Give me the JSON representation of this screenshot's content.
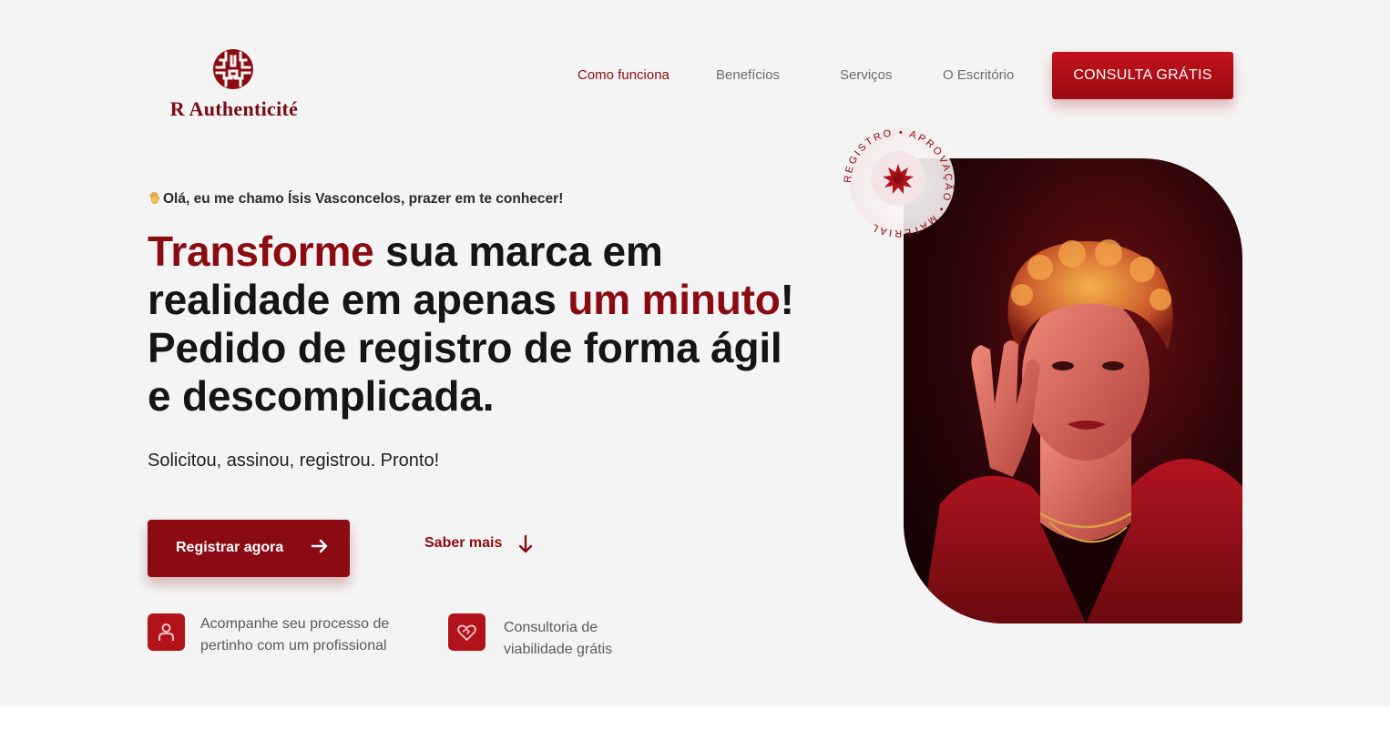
{
  "brand": {
    "name": "R Authenticité",
    "accent_color": "#8a0c12",
    "logo_icon": "circular-maze-logo-icon"
  },
  "nav": {
    "items": [
      {
        "label": "Como funciona",
        "active": true
      },
      {
        "label": "Benefícios",
        "active": false
      },
      {
        "label": "Serviços",
        "active": false
      },
      {
        "label": "O Escritório",
        "active": false
      }
    ],
    "cta_label": "CONSULTA GRÁTIS"
  },
  "hero": {
    "greeting_icon": "waving-hand-icon",
    "greeting": "Olá, eu me chamo Ísis Vasconcelos, prazer em te conhecer!",
    "headline": {
      "part1_highlight": "Transforme",
      "part2": " sua marca em realidade em apenas ",
      "part3_highlight": "um minuto",
      "part4": "! Pedido de registro de forma ágil e descomplicada."
    },
    "subline": "Solicitou, assinou, registrou. Pronto!",
    "primary_button": {
      "label": "Registrar agora",
      "icon": "arrow-right-icon"
    },
    "secondary_button": {
      "label": "Saber mais",
      "icon": "arrow-down-icon"
    },
    "features": [
      {
        "icon": "person-icon",
        "text_line1": "Acompanhe seu processo de",
        "text_line2": "pertinho com um profissional"
      },
      {
        "icon": "heart-handshake-icon",
        "text_line1": "Consultoria de",
        "text_line2": "viabilidade grátis"
      }
    ]
  },
  "badge": {
    "ring_text": "REGISTRO • APROVAÇÃO • MATERIAL",
    "icon": "starburst-seal-icon"
  },
  "photo": {
    "subject": "portrait-photo"
  }
}
